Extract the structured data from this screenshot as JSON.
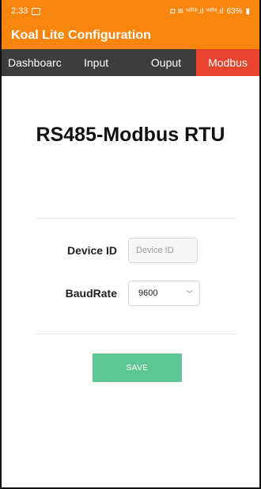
{
  "status_bar": {
    "time": "2:33",
    "indicators": "◘ ≋ ᵛᵒˡᵗᵉ.ıl ᵛᵒˡᵗᵉ.ıl",
    "battery": "63%"
  },
  "app_bar": {
    "title": "Koal Lite Configuration"
  },
  "tabs": [
    {
      "label": "Dashboarc"
    },
    {
      "label": "Input"
    },
    {
      "label": "Ouput"
    },
    {
      "label": "Modbus"
    }
  ],
  "active_tab": "Modbus",
  "main": {
    "title": "RS485-Modbus RTU",
    "device_id": {
      "label": "Device ID",
      "placeholder": "Device ID",
      "value": ""
    },
    "baud_rate": {
      "label": "BaudRate",
      "selected": "9600"
    },
    "save_label": "SAVE"
  },
  "colors": {
    "header": "#f7850e",
    "tab_bar": "#3d3d3d",
    "active_tab": "#e8432d",
    "save_button": "#5dc695"
  }
}
